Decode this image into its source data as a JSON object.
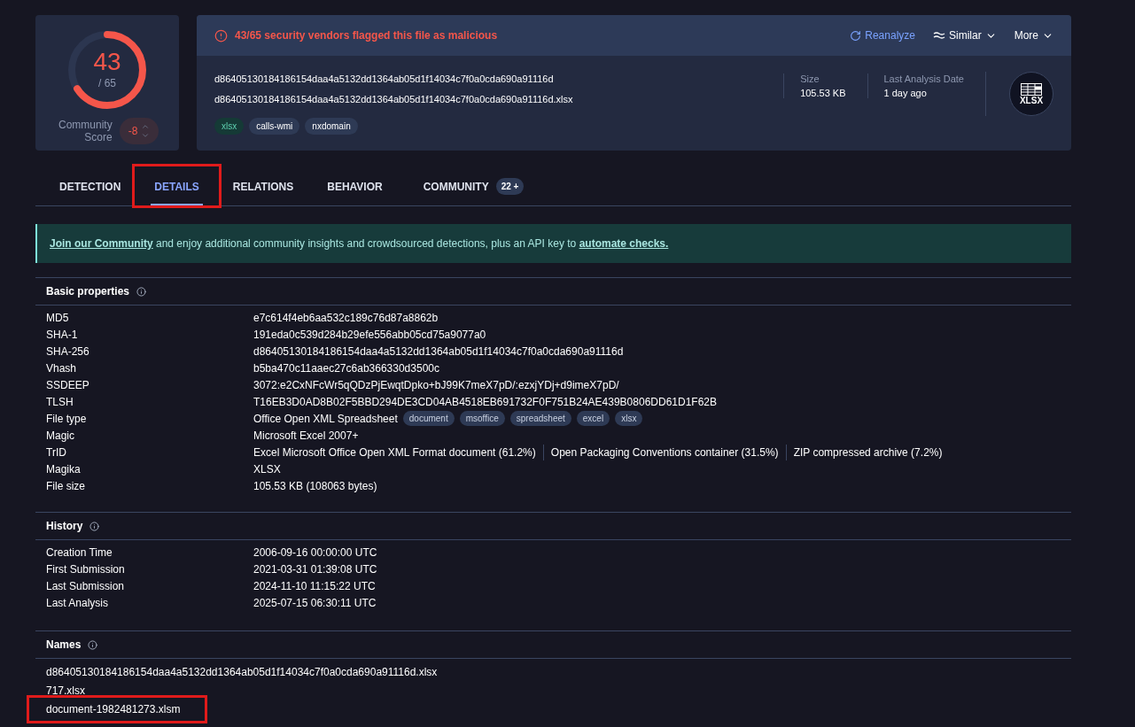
{
  "score": {
    "detections": "43",
    "total": "/ 65",
    "level": 0.66,
    "community_label": "Community Score",
    "community_value": "-8"
  },
  "header": {
    "alert": "43/65 security vendors flagged this file as malicious",
    "actions": [
      {
        "kind": "reanalyze",
        "label": "Reanalyze"
      },
      {
        "kind": "similar",
        "label": "Similar"
      },
      {
        "kind": "more",
        "label": "More"
      }
    ],
    "hash": "d86405130184186154daa4a5132dd1364ab05d1f14034c7f0a0cda690a91116d",
    "filename": "d86405130184186154daa4a5132dd1364ab05d1f14034c7f0a0cda690a91116d.xlsx",
    "tags": [
      {
        "label": "xlsx",
        "kind": "filetype"
      },
      {
        "label": "calls-wmi",
        "kind": "tag"
      },
      {
        "label": "nxdomain",
        "kind": "tag"
      }
    ],
    "stats": [
      {
        "label": "Size",
        "value": "105.53 KB"
      },
      {
        "label": "Last Analysis Date",
        "value": "1 day ago"
      }
    ],
    "file_icon_label": "XLSX"
  },
  "tabs": [
    {
      "label": "DETECTION",
      "selected": false,
      "highlighted": false
    },
    {
      "label": "DETAILS",
      "selected": true,
      "highlighted": true
    },
    {
      "label": "RELATIONS",
      "selected": false,
      "highlighted": false
    },
    {
      "label": "BEHAVIOR",
      "selected": false,
      "highlighted": false
    },
    {
      "label": "COMMUNITY",
      "selected": false,
      "highlighted": false,
      "badge": "22 +"
    }
  ],
  "banner": {
    "link_1": "Join our Community",
    "text": " and enjoy additional community insights and crowdsourced detections, plus an API key to ",
    "link_2": "automate checks."
  },
  "basic_properties": {
    "title": "Basic properties",
    "rows": [
      {
        "label": "MD5",
        "value": "e7c614f4eb6aa532c189c76d87a8862b"
      },
      {
        "label": "SHA-1",
        "value": "191eda0c539d284b29efe556abb05cd75a9077a0"
      },
      {
        "label": "SHA-256",
        "value": "d86405130184186154daa4a5132dd1364ab05d1f14034c7f0a0cda690a91116d"
      },
      {
        "label": "Vhash",
        "value": "b5ba470c11aaec27c6ab366330d3500c"
      },
      {
        "label": "SSDEEP",
        "value": "3072:e2CxNFcWr5qQDzPjEwqtDpko+bJ99K7meX7pD/:ezxjYDj+d9imeX7pD/"
      },
      {
        "label": "TLSH",
        "value": "T16EB3D0AD8B02F5BBD294DE3CD04AB4518EB691732F0F751B24AE439B0806DD61D1F62B"
      },
      {
        "label": "File type",
        "value": "Office Open XML Spreadsheet",
        "tags": [
          "document",
          "msoffice",
          "spreadsheet",
          "excel",
          "xlsx"
        ]
      },
      {
        "label": "Magic",
        "value": "Microsoft Excel 2007+"
      },
      {
        "label": "TrID",
        "parts": [
          "Excel Microsoft Office Open XML Format document (61.2%)",
          "Open Packaging Conventions container (31.5%)",
          "ZIP compressed archive (7.2%)"
        ]
      },
      {
        "label": "Magika",
        "value": "XLSX"
      },
      {
        "label": "File size",
        "value": "105.53 KB (108063 bytes)"
      }
    ]
  },
  "history": {
    "title": "History",
    "rows": [
      {
        "label": "Creation Time",
        "value": "2006-09-16 00:00:00 UTC"
      },
      {
        "label": "First Submission",
        "value": "2021-03-31 01:39:08 UTC"
      },
      {
        "label": "Last Submission",
        "value": "2024-11-10 11:15:22 UTC"
      },
      {
        "label": "Last Analysis",
        "value": "2025-07-15 06:30:11 UTC"
      }
    ]
  },
  "names": {
    "title": "Names",
    "items": [
      {
        "label": "d86405130184186154daa4a5132dd1364ab05d1f14034c7f0a0cda690a91116d.xlsx",
        "highlighted": false
      },
      {
        "label": "717.xlsx",
        "highlighted": false
      },
      {
        "label": "document-1982481273.xlsm",
        "highlighted": true
      }
    ]
  }
}
